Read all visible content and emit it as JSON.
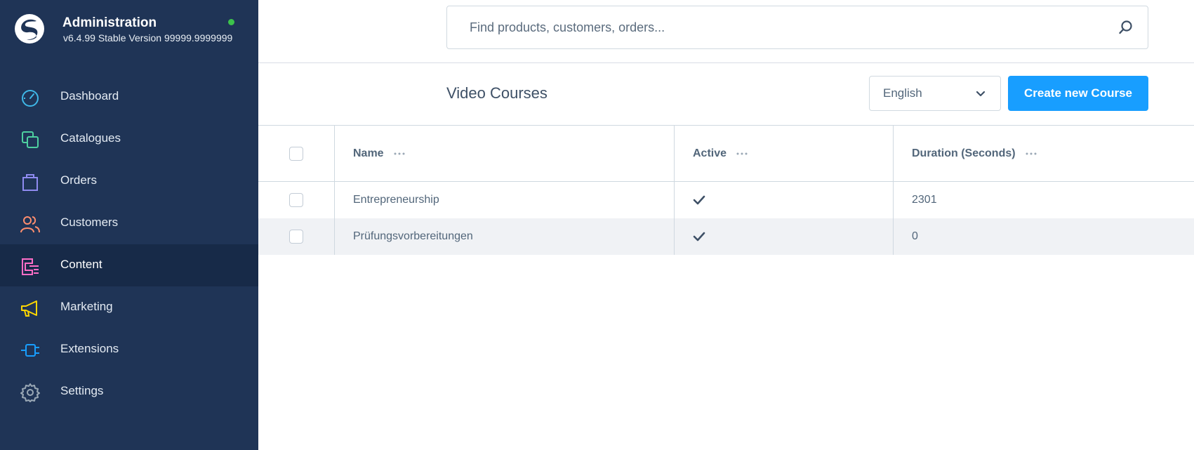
{
  "sidebar": {
    "brand": {
      "title": "Administration",
      "version": "v6.4.99 Stable Version 99999.9999999",
      "status_color": "#3cc24b"
    },
    "items": [
      {
        "label": "Dashboard",
        "icon": "dashboard-gauge-icon",
        "color": "#3fb8e8"
      },
      {
        "label": "Catalogues",
        "icon": "catalogue-icon",
        "color": "#4ed0a0"
      },
      {
        "label": "Orders",
        "icon": "shopping-bag-icon",
        "color": "#8f8bf0"
      },
      {
        "label": "Customers",
        "icon": "users-icon",
        "color": "#ff8e6e"
      },
      {
        "label": "Content",
        "icon": "content-list-icon",
        "color": "#ff6ec7",
        "active": true
      },
      {
        "label": "Marketing",
        "icon": "megaphone-icon",
        "color": "#ffd700"
      },
      {
        "label": "Extensions",
        "icon": "plug-icon",
        "color": "#189eff"
      },
      {
        "label": "Settings",
        "icon": "gear-icon",
        "color": "#9aa8b5"
      }
    ]
  },
  "search": {
    "placeholder": "Find products, customers, orders..."
  },
  "header": {
    "title": "Video Courses",
    "language": "English",
    "create_label": "Create new Course",
    "accent": "#189eff"
  },
  "table": {
    "columns": [
      "Name",
      "Active",
      "Duration (Seconds)"
    ],
    "rows": [
      {
        "name": "Entrepreneurship",
        "active": true,
        "duration": "2301"
      },
      {
        "name": "Prüfungsvorbereitungen",
        "active": true,
        "duration": "0"
      }
    ]
  }
}
